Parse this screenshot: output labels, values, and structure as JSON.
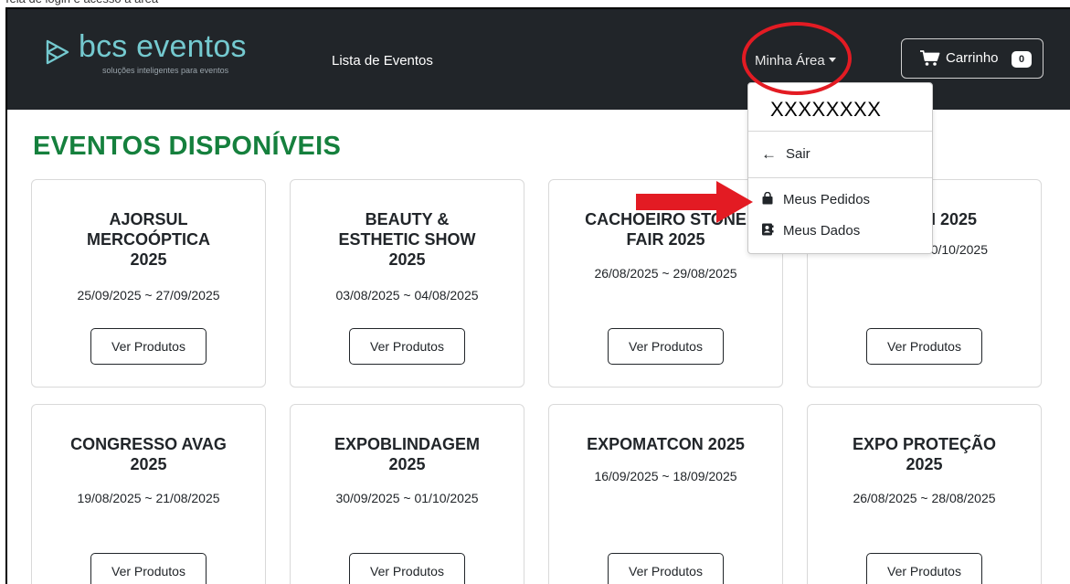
{
  "header": {
    "brand_name": "bcs eventos",
    "brand_tagline": "soluções inteligentes para eventos",
    "nav_link": "Lista de Eventos",
    "account_menu": "Minha Área",
    "cart_label": "Carrinho",
    "cart_count": "0"
  },
  "dropdown": {
    "user": "XXXXXXXX",
    "logout": "Sair",
    "orders": "Meus Pedidos",
    "profile": "Meus Dados"
  },
  "page": {
    "title": "EVENTOS DISPONÍVEIS"
  },
  "events": [
    {
      "title": "AJORSUL\nMERCOÓPTICA\n2025",
      "dates": "25/09/2025 ~ 27/09/2025",
      "button": "Ver Produtos"
    },
    {
      "title": "BEAUTY &\nESTHETIC SHOW\n2025",
      "dates": "03/08/2025 ~ 04/08/2025",
      "button": "Ver Produtos"
    },
    {
      "title": "CACHOEIRO STONE\nFAIR 2025",
      "dates": "26/08/2025 ~ 29/08/2025",
      "button": "Ver Produtos"
    },
    {
      "title": "H 2025",
      "dates": "30/10/2025",
      "button": "Ver Produtos"
    },
    {
      "title": "CONGRESSO AVAG\n2025",
      "dates": "19/08/2025 ~ 21/08/2025",
      "button": "Ver Produtos"
    },
    {
      "title": "EXPOBLINDAGEM\n2025",
      "dates": "30/09/2025 ~ 01/10/2025",
      "button": "Ver Produtos"
    },
    {
      "title": "EXPOMATCON 2025",
      "dates": "16/09/2025 ~ 18/09/2025",
      "button": "Ver Produtos"
    },
    {
      "title": "EXPO PROTEÇÃO\n2025",
      "dates": "26/08/2025 ~ 28/08/2025",
      "button": "Ver Produtos"
    }
  ],
  "colors": {
    "navbar": "#212529",
    "brand": "#74c9cf",
    "title_green": "#15803d",
    "annotation_red": "#e31b23"
  },
  "icons": {
    "brand": "play-triangle-logo-icon",
    "cart": "shopping-cart-icon",
    "logout": "arrow-left-icon",
    "orders": "shopping-bag-icon",
    "profile": "address-book-icon"
  }
}
